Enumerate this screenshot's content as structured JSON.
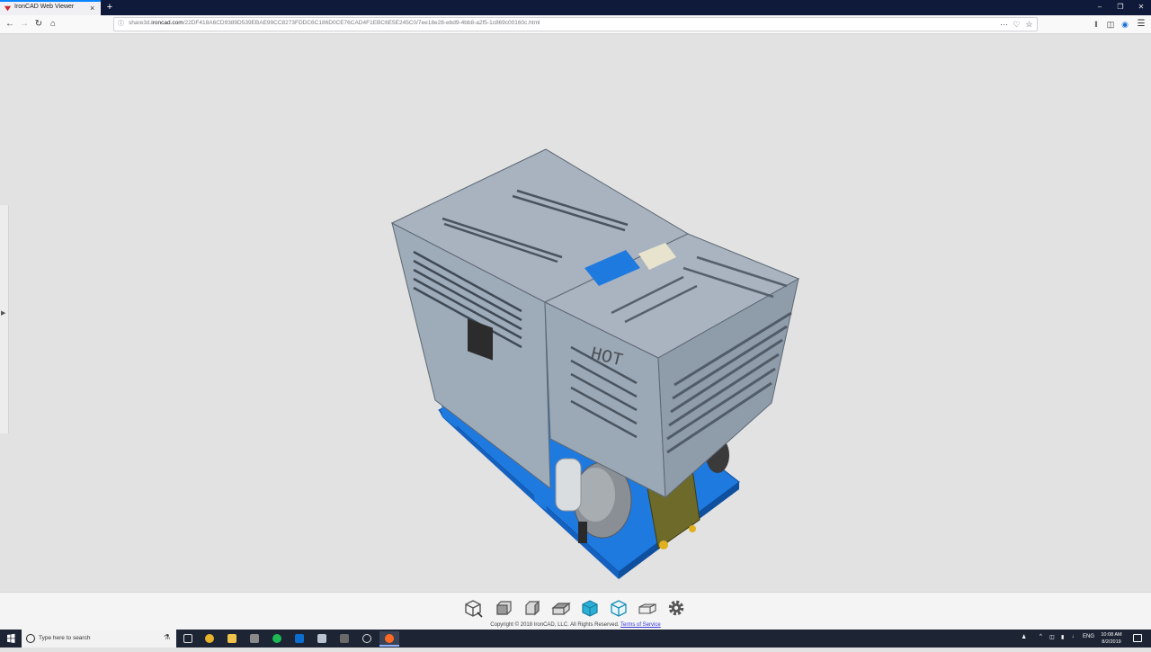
{
  "browser": {
    "tab_title": "IronCAD Web Viewer",
    "tab_close": "×",
    "new_tab": "+",
    "url_prefix": "share3d.",
    "url_domain": "ironcad.com",
    "url_path": "/22DF418A6CD9389D539EBAE99CC8273FDDC6C186D0CE76CAD4F1EBC6E5E245C0/7ee18e28-ebd9-4bb8-a2f5-1c869c00160c.html"
  },
  "viewer": {
    "label_hot": "HOT",
    "colors": {
      "panel": "#a8b3bf",
      "base": "#1f7ae0",
      "background": "#e2e2e2"
    }
  },
  "toolbar": {
    "items": [
      {
        "icon": "fit-view-icon"
      },
      {
        "icon": "front-view-icon"
      },
      {
        "icon": "side-view-icon"
      },
      {
        "icon": "top-view-icon"
      },
      {
        "icon": "shaded-view-icon"
      },
      {
        "icon": "wireframe-view-icon"
      },
      {
        "icon": "section-view-icon"
      },
      {
        "icon": "settings-gear-icon"
      }
    ],
    "copyright": "Copyright © 2018 IronCAD, LLC. All Rights Reserved.",
    "terms_link": "Terms of Service"
  },
  "taskbar": {
    "search_placeholder": "Type here to search",
    "language": "ENG",
    "time": "10:08 AM",
    "date": "8/2/2019"
  }
}
